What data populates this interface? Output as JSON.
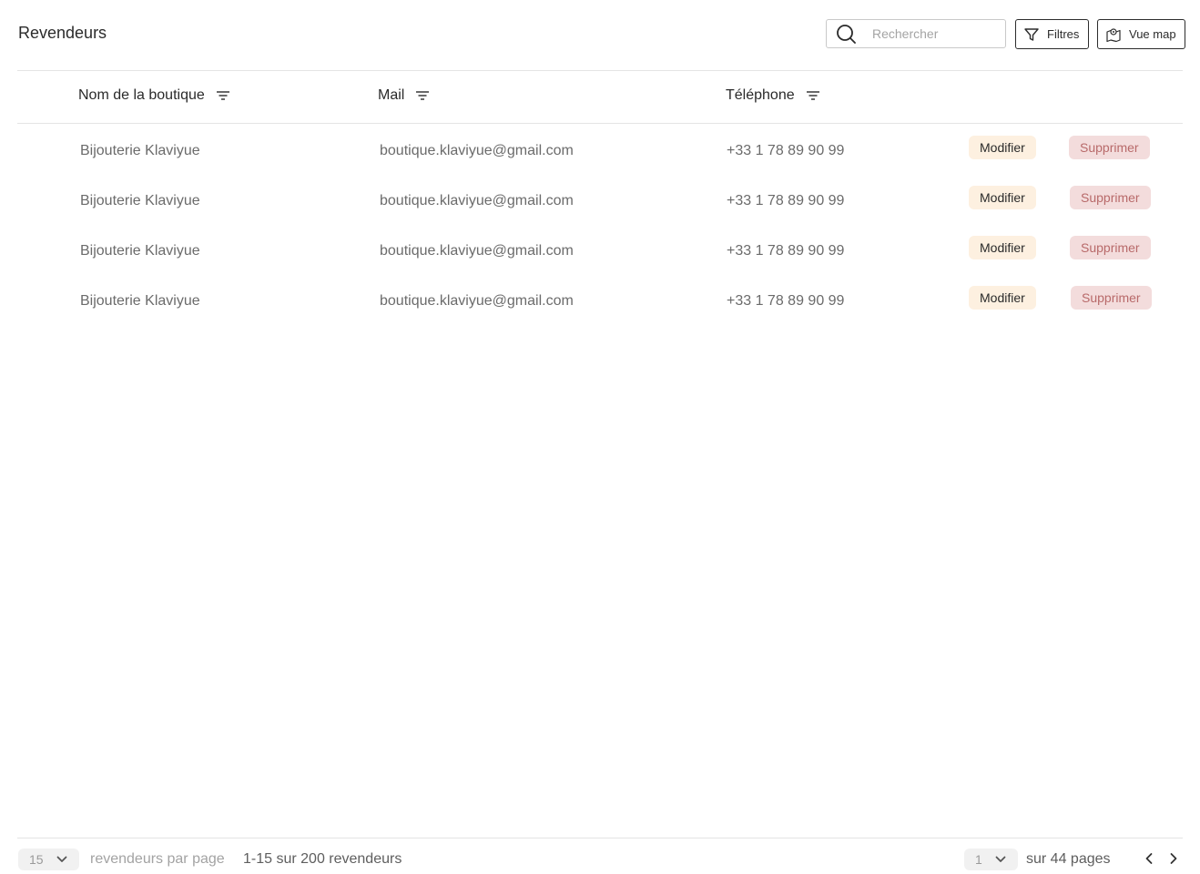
{
  "header": {
    "title": "Revendeurs",
    "search_placeholder": "Rechercher",
    "filters_label": "Filtres",
    "map_label": "Vue map"
  },
  "table": {
    "columns": [
      "Nom de la boutique",
      "Mail",
      "Téléphone"
    ],
    "rows": [
      {
        "name": "Bijouterie Klaviyue",
        "mail": "boutique.klaviyue@gmail.com",
        "phone": "+33 1 78 89 90 99"
      },
      {
        "name": "Bijouterie Klaviyue",
        "mail": "boutique.klaviyue@gmail.com",
        "phone": "+33 1 78 89 90 99"
      },
      {
        "name": "Bijouterie Klaviyue",
        "mail": "boutique.klaviyue@gmail.com",
        "phone": "+33 1 78 89 90 99"
      },
      {
        "name": "Bijouterie Klaviyue",
        "mail": "boutique.klaviyue@gmail.com",
        "phone": "+33 1 78 89 90 99"
      }
    ],
    "edit_label": "Modifier",
    "delete_label": "Supprimer"
  },
  "footer": {
    "per_page_value": "15",
    "per_page_label": "revendeurs par page",
    "range_text": "1-15 sur 200 revendeurs",
    "page_value": "1",
    "pages_text": "sur 44 pages"
  },
  "colors": {
    "edit_bg": "#fdf0e0",
    "delete_bg": "#f3dcdc",
    "delete_text": "#b86a6a"
  }
}
